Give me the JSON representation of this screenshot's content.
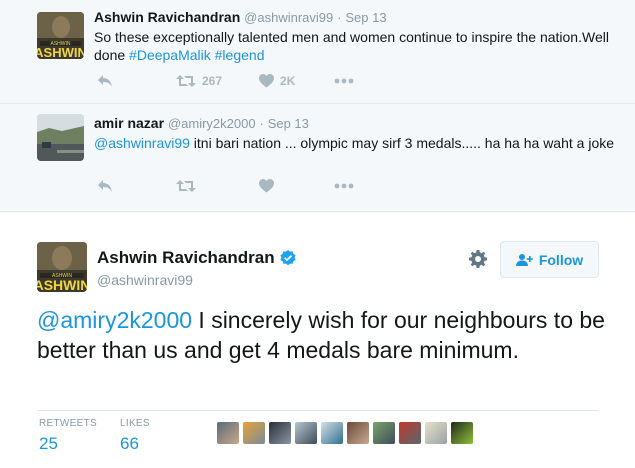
{
  "thread": [
    {
      "name": "Ashwin Ravichandran",
      "handle": "@ashwinravi99",
      "time": "Sep 13",
      "text_before": "So these exceptionally talented men and women continue to inspire the nation.Well done ",
      "hashtags": "#DeepaMalik #legend",
      "retweets": "267",
      "likes": "2K",
      "avatar_text_top": "ASHWIN",
      "avatar_text_main": "ASHWIN"
    },
    {
      "name": "amir nazar",
      "handle": "@amiry2k2000",
      "time": "Sep 13",
      "mention": "@ashwinravi99",
      "text_after": " itni bari nation ... olympic may sirf 3 medals..... ha ha ha waht a joke"
    }
  ],
  "main_tweet": {
    "name": "Ashwin Ravichandran",
    "handle": "@ashwinravi99",
    "follow_label": "Follow",
    "mention": "@amiry2k2000",
    "text": " I sincerely wish for our neighbours to be better than us and get 4 medals bare minimum.",
    "retweets_label": "RETWEETS",
    "retweets": "25",
    "likes_label": "LIKES",
    "likes": "66"
  },
  "icons": [
    "reply-icon",
    "retweet-icon",
    "heart-icon",
    "more-icon",
    "gear-icon",
    "follow-person-icon",
    "verified-icon"
  ],
  "colors": {
    "link": "#1b95e0",
    "muted": "#8899a6",
    "icon": "#aab8c2",
    "thread_bg": "#f5f8fa"
  }
}
